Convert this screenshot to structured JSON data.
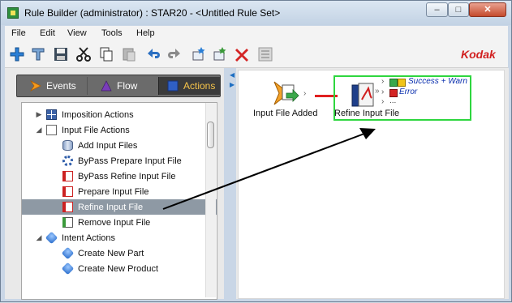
{
  "window": {
    "title": "Rule Builder (administrator) : STAR20 - <Untitled Rule Set>",
    "min_label": "–",
    "max_label": "□",
    "close_label": "✕"
  },
  "menu": [
    "File",
    "Edit",
    "View",
    "Tools",
    "Help"
  ],
  "brand": "Kodak",
  "tabs": [
    {
      "label": "Events",
      "icon": "events-arrow-icon"
    },
    {
      "label": "Flow",
      "icon": "flow-triangle-icon"
    },
    {
      "label": "Actions",
      "icon": "actions-square-icon",
      "selected": true
    }
  ],
  "tree": [
    {
      "label": "Imposition Actions",
      "icon": "imposition-grid-icon",
      "level": 1,
      "expander": "▶"
    },
    {
      "label": "Input File Actions",
      "icon": "document-icon",
      "level": 1,
      "expander": "◢"
    },
    {
      "label": "Add Input Files",
      "icon": "database-icon",
      "level": 2
    },
    {
      "label": "ByPass Prepare Input File",
      "icon": "gear-icon",
      "level": 2
    },
    {
      "label": "ByPass Refine Input File",
      "icon": "pdf-icon",
      "level": 2
    },
    {
      "label": "Prepare Input File",
      "icon": "pdf-icon",
      "level": 2
    },
    {
      "label": "Refine Input File",
      "icon": "pdf-icon",
      "level": 2,
      "selected": true
    },
    {
      "label": "Remove Input File",
      "icon": "remove-file-icon",
      "level": 2
    },
    {
      "label": "Intent Actions",
      "icon": "intent-cube-icon",
      "level": 1,
      "expander": "◢"
    },
    {
      "label": "Create New Part",
      "icon": "intent-cube-icon",
      "level": 2
    },
    {
      "label": "Create New Product",
      "icon": "intent-cube-icon",
      "level": 2
    }
  ],
  "canvas": {
    "node1_label": "Input File Added",
    "node2_label": "Refine Input File",
    "outcome_success": "Success + Warn",
    "outcome_error": "Error",
    "outcome_more": "..."
  },
  "colors": {
    "selection_box": "#2ed63f",
    "link": "#e02020",
    "accent_tab_text": "#f7c54a",
    "outcome_text": "#0a2fae"
  }
}
